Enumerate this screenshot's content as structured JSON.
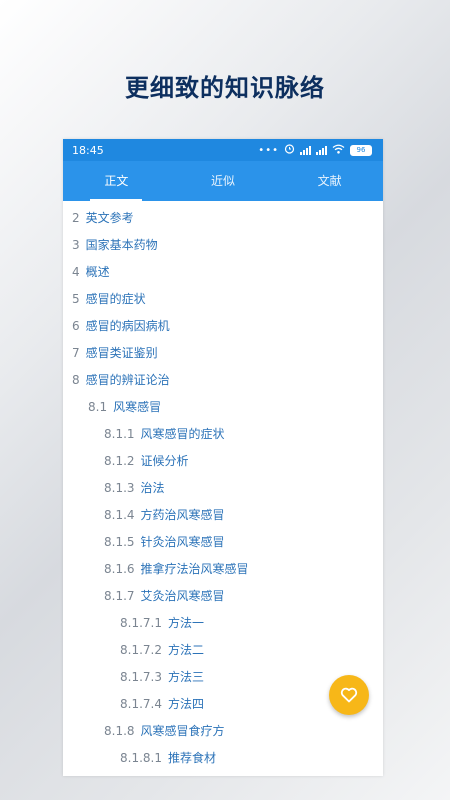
{
  "headline": "更细致的知识脉络",
  "status_bar": {
    "time": "18:45",
    "battery": "96"
  },
  "tabs": [
    {
      "label": "正文",
      "active": true
    },
    {
      "label": "近似",
      "active": false
    },
    {
      "label": "文献",
      "active": false
    }
  ],
  "toc": [
    {
      "num": "2",
      "title": "英文参考"
    },
    {
      "num": "3",
      "title": "国家基本药物"
    },
    {
      "num": "4",
      "title": "概述"
    },
    {
      "num": "5",
      "title": "感冒的症状"
    },
    {
      "num": "6",
      "title": "感冒的病因病机"
    },
    {
      "num": "7",
      "title": "感冒类证鉴别"
    },
    {
      "num": "8",
      "title": "感冒的辨证论治"
    },
    {
      "num": "8.1",
      "title": "风寒感冒"
    },
    {
      "num": "8.1.1",
      "title": "风寒感冒的症状"
    },
    {
      "num": "8.1.2",
      "title": "证候分析"
    },
    {
      "num": "8.1.3",
      "title": "治法"
    },
    {
      "num": "8.1.4",
      "title": "方药治风寒感冒"
    },
    {
      "num": "8.1.5",
      "title": "针灸治风寒感冒"
    },
    {
      "num": "8.1.6",
      "title": "推拿疗法治风寒感冒"
    },
    {
      "num": "8.1.7",
      "title": "艾灸治风寒感冒"
    },
    {
      "num": "8.1.7.1",
      "title": "方法一"
    },
    {
      "num": "8.1.7.2",
      "title": "方法二"
    },
    {
      "num": "8.1.7.3",
      "title": "方法三"
    },
    {
      "num": "8.1.7.4",
      "title": "方法四"
    },
    {
      "num": "8.1.8",
      "title": "风寒感冒食疗方"
    },
    {
      "num": "8.1.8.1",
      "title": "推荐食材"
    }
  ],
  "colors": {
    "status_bar": "#1f88e0",
    "tab_bar": "#2b93ea",
    "link": "#2c73b8",
    "fab": "#f7b718",
    "headline": "#0d2f5f"
  },
  "fab_icon": "heart-icon"
}
